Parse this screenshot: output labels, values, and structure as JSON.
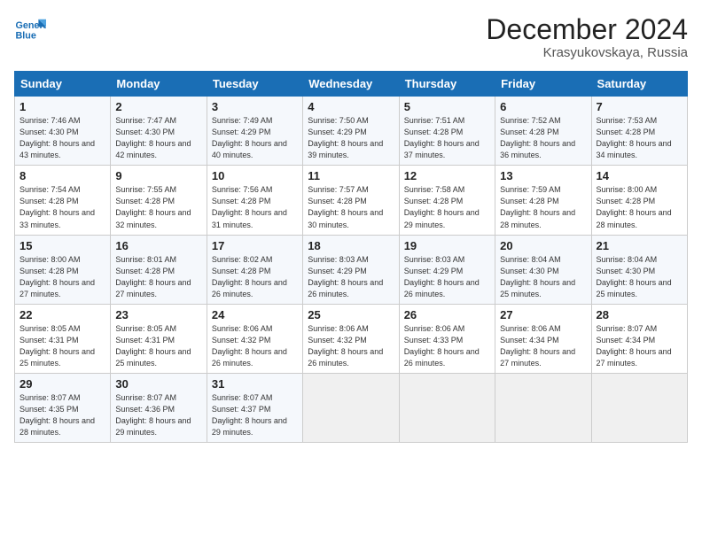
{
  "logo": {
    "line1": "General",
    "line2": "Blue"
  },
  "header": {
    "month": "December 2024",
    "location": "Krasyukovskaya, Russia"
  },
  "weekdays": [
    "Sunday",
    "Monday",
    "Tuesday",
    "Wednesday",
    "Thursday",
    "Friday",
    "Saturday"
  ],
  "weeks": [
    [
      {
        "day": "1",
        "sunrise": "7:46 AM",
        "sunset": "4:30 PM",
        "daylight": "8 hours and 43 minutes."
      },
      {
        "day": "2",
        "sunrise": "7:47 AM",
        "sunset": "4:30 PM",
        "daylight": "8 hours and 42 minutes."
      },
      {
        "day": "3",
        "sunrise": "7:49 AM",
        "sunset": "4:29 PM",
        "daylight": "8 hours and 40 minutes."
      },
      {
        "day": "4",
        "sunrise": "7:50 AM",
        "sunset": "4:29 PM",
        "daylight": "8 hours and 39 minutes."
      },
      {
        "day": "5",
        "sunrise": "7:51 AM",
        "sunset": "4:28 PM",
        "daylight": "8 hours and 37 minutes."
      },
      {
        "day": "6",
        "sunrise": "7:52 AM",
        "sunset": "4:28 PM",
        "daylight": "8 hours and 36 minutes."
      },
      {
        "day": "7",
        "sunrise": "7:53 AM",
        "sunset": "4:28 PM",
        "daylight": "8 hours and 34 minutes."
      }
    ],
    [
      {
        "day": "8",
        "sunrise": "7:54 AM",
        "sunset": "4:28 PM",
        "daylight": "8 hours and 33 minutes."
      },
      {
        "day": "9",
        "sunrise": "7:55 AM",
        "sunset": "4:28 PM",
        "daylight": "8 hours and 32 minutes."
      },
      {
        "day": "10",
        "sunrise": "7:56 AM",
        "sunset": "4:28 PM",
        "daylight": "8 hours and 31 minutes."
      },
      {
        "day": "11",
        "sunrise": "7:57 AM",
        "sunset": "4:28 PM",
        "daylight": "8 hours and 30 minutes."
      },
      {
        "day": "12",
        "sunrise": "7:58 AM",
        "sunset": "4:28 PM",
        "daylight": "8 hours and 29 minutes."
      },
      {
        "day": "13",
        "sunrise": "7:59 AM",
        "sunset": "4:28 PM",
        "daylight": "8 hours and 28 minutes."
      },
      {
        "day": "14",
        "sunrise": "8:00 AM",
        "sunset": "4:28 PM",
        "daylight": "8 hours and 28 minutes."
      }
    ],
    [
      {
        "day": "15",
        "sunrise": "8:00 AM",
        "sunset": "4:28 PM",
        "daylight": "8 hours and 27 minutes."
      },
      {
        "day": "16",
        "sunrise": "8:01 AM",
        "sunset": "4:28 PM",
        "daylight": "8 hours and 27 minutes."
      },
      {
        "day": "17",
        "sunrise": "8:02 AM",
        "sunset": "4:28 PM",
        "daylight": "8 hours and 26 minutes."
      },
      {
        "day": "18",
        "sunrise": "8:03 AM",
        "sunset": "4:29 PM",
        "daylight": "8 hours and 26 minutes."
      },
      {
        "day": "19",
        "sunrise": "8:03 AM",
        "sunset": "4:29 PM",
        "daylight": "8 hours and 26 minutes."
      },
      {
        "day": "20",
        "sunrise": "8:04 AM",
        "sunset": "4:30 PM",
        "daylight": "8 hours and 25 minutes."
      },
      {
        "day": "21",
        "sunrise": "8:04 AM",
        "sunset": "4:30 PM",
        "daylight": "8 hours and 25 minutes."
      }
    ],
    [
      {
        "day": "22",
        "sunrise": "8:05 AM",
        "sunset": "4:31 PM",
        "daylight": "8 hours and 25 minutes."
      },
      {
        "day": "23",
        "sunrise": "8:05 AM",
        "sunset": "4:31 PM",
        "daylight": "8 hours and 25 minutes."
      },
      {
        "day": "24",
        "sunrise": "8:06 AM",
        "sunset": "4:32 PM",
        "daylight": "8 hours and 26 minutes."
      },
      {
        "day": "25",
        "sunrise": "8:06 AM",
        "sunset": "4:32 PM",
        "daylight": "8 hours and 26 minutes."
      },
      {
        "day": "26",
        "sunrise": "8:06 AM",
        "sunset": "4:33 PM",
        "daylight": "8 hours and 26 minutes."
      },
      {
        "day": "27",
        "sunrise": "8:06 AM",
        "sunset": "4:34 PM",
        "daylight": "8 hours and 27 minutes."
      },
      {
        "day": "28",
        "sunrise": "8:07 AM",
        "sunset": "4:34 PM",
        "daylight": "8 hours and 27 minutes."
      }
    ],
    [
      {
        "day": "29",
        "sunrise": "8:07 AM",
        "sunset": "4:35 PM",
        "daylight": "8 hours and 28 minutes."
      },
      {
        "day": "30",
        "sunrise": "8:07 AM",
        "sunset": "4:36 PM",
        "daylight": "8 hours and 29 minutes."
      },
      {
        "day": "31",
        "sunrise": "8:07 AM",
        "sunset": "4:37 PM",
        "daylight": "8 hours and 29 minutes."
      },
      null,
      null,
      null,
      null
    ]
  ]
}
